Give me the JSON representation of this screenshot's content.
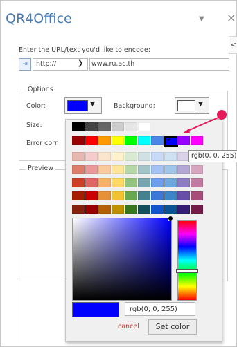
{
  "header": {
    "title": "QR4Office",
    "pin_icon": "chevron-down-icon",
    "close_glyph": "×"
  },
  "side_tab": {
    "glyph": "<"
  },
  "form": {
    "prompt": "Enter the URL/text you'd like to encode:",
    "protocol": "http://",
    "url_value": "www.ru.ac.th"
  },
  "options": {
    "legend": "Options",
    "color_label": "Color:",
    "color_value": "#0000ff",
    "background_label": "Background:",
    "background_value": "#ffffff",
    "size_label": "Size:",
    "error_label": "Error corr"
  },
  "preview": {
    "legend": "Preview"
  },
  "color_picker": {
    "tooltip": "rgb(0, 0, 255)",
    "grays": [
      "#000000",
      "#444444",
      "#666666",
      "#cccccc",
      "#e6e6e6",
      "#ffffff"
    ],
    "palette": [
      [
        "#990000",
        "#ff0000",
        "#ff9900",
        "#ffff00",
        "#00ff00",
        "#00ffff",
        "#4a86e8",
        "#0000ff",
        "#9900ff",
        "#ff00ff"
      ],
      [
        "#e6b8af",
        "#f4cccc",
        "#fce5cd",
        "#fff2cc",
        "#d9ead3",
        "#d0e0e3",
        "#c9daf8",
        "#cfe2f3",
        "#d9d2e9",
        "#ead1dc"
      ],
      [
        "#dd7e6b",
        "#ea9999",
        "#f9cb9c",
        "#ffe599",
        "#b6d7a8",
        "#a2c4c9",
        "#a4c2f4",
        "#9fc5e8",
        "#b4a7d6",
        "#d5a6bd"
      ],
      [
        "#cc4125",
        "#e06666",
        "#f6b26b",
        "#ffd966",
        "#93c47d",
        "#76a5af",
        "#6d9eeb",
        "#6fa8dc",
        "#8e7cc3",
        "#c27ba0"
      ],
      [
        "#a61c00",
        "#cc0000",
        "#e69138",
        "#f1c232",
        "#6aa84f",
        "#45818e",
        "#3c78d8",
        "#3d85c6",
        "#674ea7",
        "#a64d79"
      ],
      [
        "#85200c",
        "#990000",
        "#b45f06",
        "#bf9000",
        "#38761d",
        "#134f5c",
        "#1155cc",
        "#0b5394",
        "#351c75",
        "#741b47"
      ]
    ],
    "selected_hex": "#0000ff",
    "rgb_value": "rgb(0, 0, 255)",
    "cancel_label": "cancel",
    "set_label": "Set color"
  },
  "annotation": {
    "color": "#e8185a"
  }
}
